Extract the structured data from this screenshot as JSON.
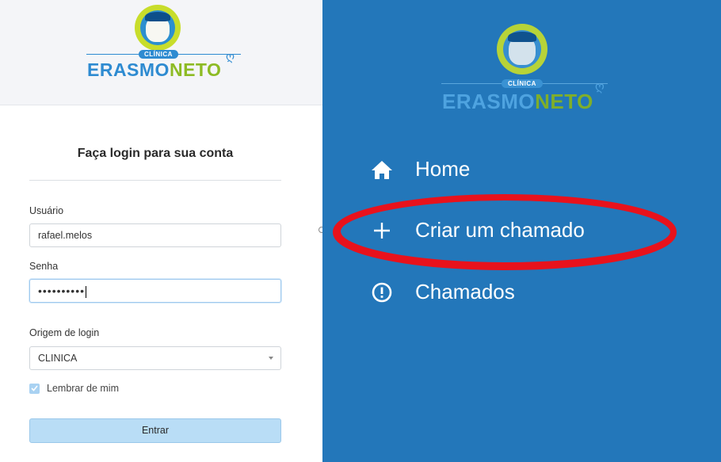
{
  "left": {
    "logo": {
      "pill": "CLÍNICA",
      "brand_a": "ERASMO",
      "brand_b": "NETO"
    },
    "title": "Faça login para sua conta",
    "username": {
      "label": "Usuário",
      "value": "rafael.melos"
    },
    "password": {
      "label": "Senha",
      "value": "••••••••••"
    },
    "origin": {
      "label": "Origem de login",
      "selected": "CLINICA"
    },
    "remember": {
      "label": "Lembrar de mim",
      "checked": true
    },
    "submit": "Entrar"
  },
  "right": {
    "logo": {
      "pill": "CLÍNICA",
      "brand_a": "ERASMO",
      "brand_b": "NETO"
    },
    "menu": [
      {
        "label": "Home",
        "icon": "home-icon"
      },
      {
        "label": "Criar um chamado",
        "icon": "plus-icon"
      },
      {
        "label": "Chamados",
        "icon": "alert-circle-icon"
      }
    ],
    "highlight_color": "#e8121c"
  },
  "colors": {
    "brand_blue": "#2e8bd1",
    "brand_green": "#8dbb24",
    "sidebar": "#2377ba"
  }
}
